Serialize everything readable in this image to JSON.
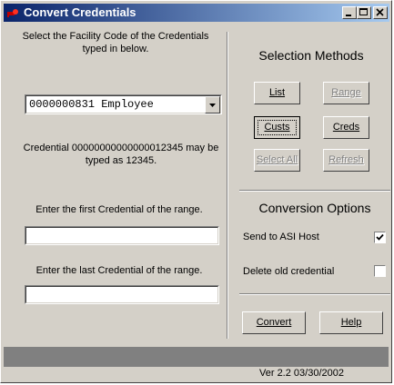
{
  "window": {
    "title": "Convert Credentials"
  },
  "left": {
    "facility_prompt": "Select the Facility Code of the Credentials typed in below.",
    "facility_selected": "0000000831 Employee",
    "credential_note": "Credential 00000000000000012345 may be typed as 12345.",
    "first_label": "Enter the first Credential of the range.",
    "first_value": "",
    "last_label": "Enter the last Credential of the range.",
    "last_value": ""
  },
  "selection": {
    "heading": "Selection Methods",
    "list": "List",
    "range": "Range",
    "custs": "Custs",
    "creds": "Creds",
    "select_all": "Select All",
    "refresh": "Refresh"
  },
  "conversion": {
    "heading": "Conversion Options",
    "send_label": "Send to ASI Host",
    "send_checked": true,
    "delete_label": "Delete old credential",
    "delete_checked": false
  },
  "actions": {
    "convert": "Convert",
    "help": "Help"
  },
  "status": {
    "version": "Ver 2.2  03/30/2002"
  },
  "icons": {
    "app": "red-key-icon",
    "minimize": "minimize-icon",
    "maximize": "maximize-icon",
    "close": "close-icon"
  }
}
